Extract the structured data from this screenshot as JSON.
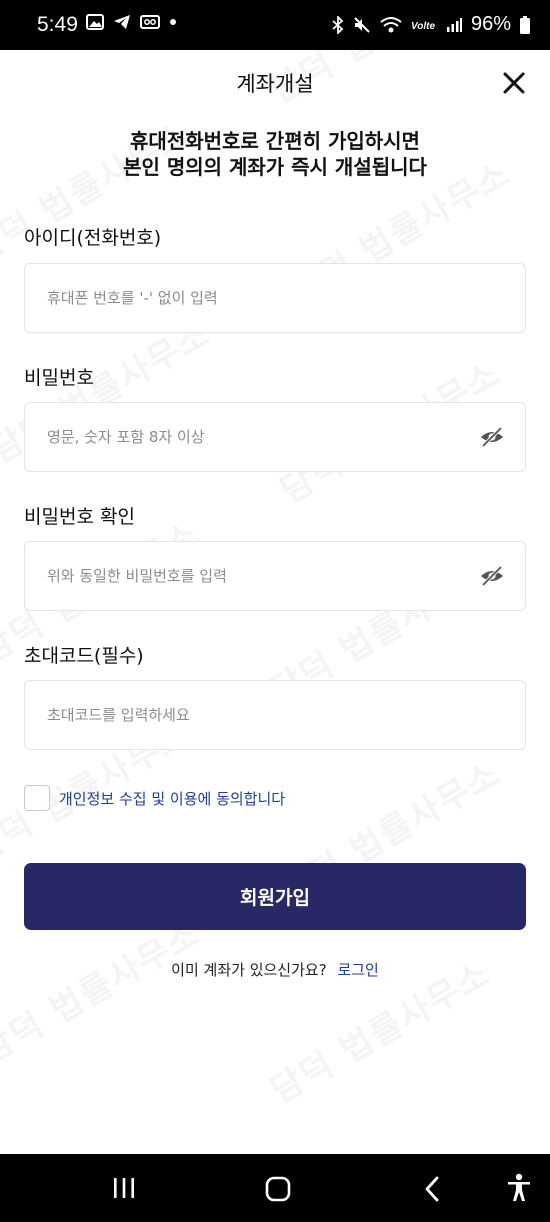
{
  "status_bar": {
    "time": "5:49",
    "battery": "96%",
    "left_icons": [
      "image-icon",
      "telegram-icon",
      "voicemail-icon",
      "dot-icon"
    ],
    "right_icons": [
      "bluetooth-icon",
      "mute-icon",
      "wifi-icon",
      "volte-icon",
      "signal-icon",
      "battery-icon"
    ]
  },
  "watermark_text": "담덕 법률사무소",
  "header": {
    "title": "계좌개설",
    "close_icon": "close-icon"
  },
  "intro": {
    "line1": "휴대전화번호로 간편히 가입하시면",
    "line2": "본인 명의의 계좌가 즉시 개설됩니다"
  },
  "form": {
    "id_label": "아이디(전화번호)",
    "id_placeholder": "휴대폰 번호를 '-' 없이 입력",
    "password_label": "비밀번호",
    "password_placeholder": "영문, 숫자 포함 8자 이상",
    "password_confirm_label": "비밀번호 확인",
    "password_confirm_placeholder": "위와 동일한 비밀번호를 입력",
    "invite_label": "초대코드(필수)",
    "invite_placeholder": "초대코드를 입력하세요"
  },
  "agreement": {
    "text": "개인정보 수집 및 이용에 동의합니다"
  },
  "signup_button": "회원가입",
  "login_prompt": {
    "question": "이미 계좌가 있으신가요?",
    "link": "로그인"
  },
  "colors": {
    "primary": "#272865",
    "link": "#1f3e9e",
    "border": "#e4e4e4"
  },
  "nav_bar": {
    "icons": [
      "recent-apps-icon",
      "home-icon",
      "back-icon",
      "accessibility-icon"
    ]
  }
}
